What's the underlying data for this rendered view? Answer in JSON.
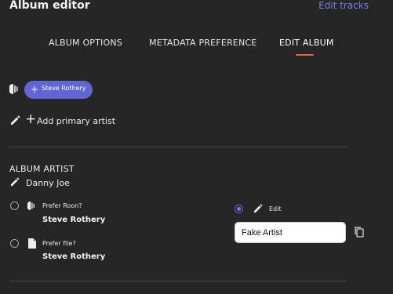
{
  "header": {
    "title": "Album editor",
    "edit_tracks_link": "Edit tracks"
  },
  "tabs": [
    {
      "label": "ALBUM OPTIONS",
      "active": false
    },
    {
      "label": "METADATA PREFERENCE",
      "active": false
    },
    {
      "label": "EDIT ALBUM",
      "active": true
    }
  ],
  "colors": {
    "background": "#262626",
    "accent": "#6266d4",
    "link": "#7b7ee0",
    "tab_indicator": "#e0645a"
  },
  "artist_chip": {
    "icon": "roon-icon",
    "plus": "+",
    "label": "Steve Rothery"
  },
  "add_primary_artist": {
    "icon": "pencil-icon",
    "plus": "+",
    "label": "Add primary artist"
  },
  "album_artist": {
    "heading": "ALBUM ARTIST",
    "current_value": "Danny Joe",
    "options": [
      {
        "label": "Prefer Roon?",
        "icon": "roon-icon",
        "value": "Steve Rothery",
        "selected": false
      },
      {
        "label": "Prefer file?",
        "icon": "file-icon",
        "value": "Steve Rothery",
        "selected": false
      },
      {
        "label": "Edit",
        "icon": "pencil-icon",
        "selected": true
      }
    ],
    "edit_input_value": "Fake Artist",
    "copy_icon": "copy-icon"
  }
}
